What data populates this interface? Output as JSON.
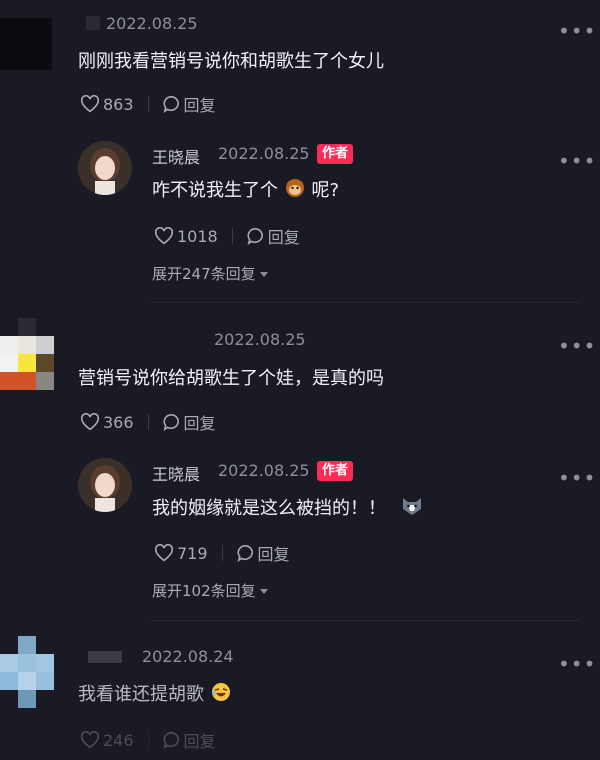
{
  "comments": [
    {
      "date": "2022.08.25",
      "text": "刚刚我看营销号说你和胡歌生了个女儿",
      "likes": "863",
      "reply_label": "回复",
      "author_reply": {
        "name": "王晓晨",
        "date": "2022.08.25",
        "badge": "作者",
        "text_before": "咋不说我生了个",
        "emoji": "monkey",
        "text_after": "呢?",
        "likes": "1018",
        "reply_label": "回复",
        "expand": "展开247条回复"
      }
    },
    {
      "date": "2022.08.25",
      "text": "营销号说你给胡歌生了个娃，是真的吗",
      "likes": "366",
      "reply_label": "回复",
      "author_reply": {
        "name": "王晓晨",
        "date": "2022.08.25",
        "badge": "作者",
        "text_before": "我的姻缘就是这么被挡的！！",
        "emoji": "husky",
        "text_after": "",
        "likes": "719",
        "reply_label": "回复",
        "expand": "展开102条回复"
      }
    },
    {
      "date": "2022.08.24",
      "text": "我看谁还提胡歌",
      "emoji": "laughing",
      "likes": "246",
      "reply_label": "回复"
    }
  ],
  "colors": {
    "background": "#191a23",
    "author_badge": "#fe2c55"
  }
}
